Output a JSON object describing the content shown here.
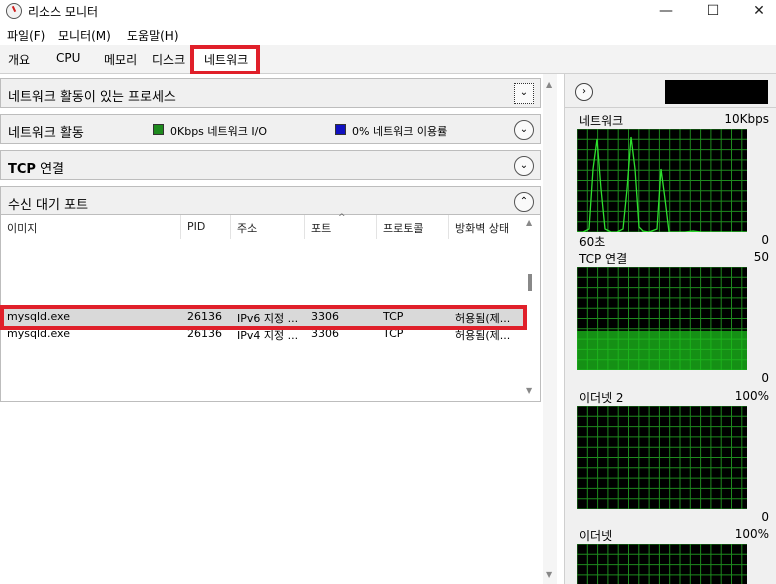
{
  "window": {
    "title": "리소스 모니터",
    "controls": {
      "minimize": "—",
      "maximize": "☐",
      "close": "✕"
    }
  },
  "menu": {
    "file": "파일(F)",
    "monitor": "모니터(M)",
    "help": "도움말(H)"
  },
  "tabs": {
    "overview": "개요",
    "cpu": "CPU",
    "memory": "메모리",
    "disk": "디스크",
    "network": "네트워크"
  },
  "sections": {
    "processes": "네트워크 활동이 있는 프로세스",
    "activity": "네트워크 활동",
    "io_legend": "0Kbps 네트워크 I/O",
    "util_legend": "0% 네트워크 이용률",
    "tcp_bold": "TCP",
    "tcp_rest": " 연결",
    "listen": "수신 대기 포트"
  },
  "listen_table": {
    "columns": [
      "이미지",
      "PID",
      "주소",
      "포트",
      "프로토콜",
      "방화벽 상태"
    ],
    "rows": [
      [
        "mysqld.exe",
        "26136",
        "IPv6 지정 ...",
        "3306",
        "TCP",
        "허용됨(제..."
      ],
      [
        "mysqld.exe",
        "26136",
        "IPv4 지정 ...",
        "3306",
        "TCP",
        "허용됨(제..."
      ]
    ]
  },
  "graphs": {
    "network": {
      "label": "네트워크",
      "max": "10Kbps",
      "bottom_left": "60초",
      "bottom_right": "0"
    },
    "tcp": {
      "label": "TCP 연결",
      "max": "50",
      "bottom_right": "0",
      "level": 0.38
    },
    "ethernet2": {
      "label": "이더넷 2",
      "max": "100%",
      "bottom_right": "0"
    },
    "ethernet": {
      "label": "이더넷",
      "max": "100%"
    }
  },
  "colors": {
    "highlight": "#e0202a",
    "graph_bg": "#000000",
    "graph_grid": "#1e8a1e",
    "graph_line": "#2ee02e",
    "io_legend": "#1e8a1e",
    "util_legend": "#1010c0"
  }
}
